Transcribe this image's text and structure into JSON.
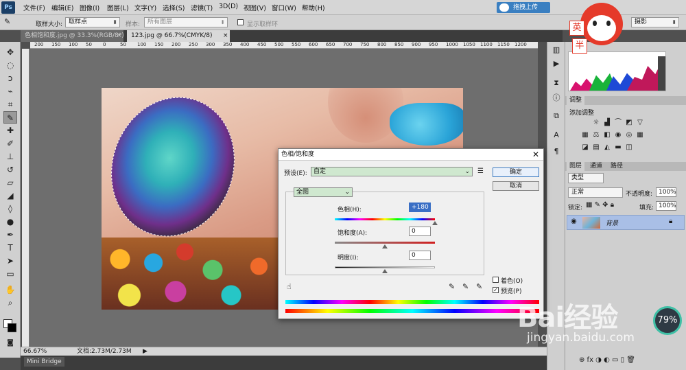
{
  "menubar": {
    "logo": "Ps",
    "items": [
      "文件(F)",
      "编辑(E)",
      "图像(I)",
      "图层(L)",
      "文字(Y)",
      "选择(S)",
      "滤镜(T)",
      "3D(D)",
      "视图(V)",
      "窗口(W)",
      "帮助(H)"
    ],
    "upload_label": "拖拽上传",
    "workspace": "摄影"
  },
  "options": {
    "sample_size_label": "取样大小:",
    "sample_size_value": "取样点",
    "sample_label": "样本:",
    "sample_value": "所有图层",
    "show_ring_label": "显示取样环"
  },
  "tabs": [
    {
      "label": "色相饱和度.jpg @ 33.3%(RGB/8*)",
      "close": "×"
    },
    {
      "label": "123.jpg @ 66.7%(CMYK/8)",
      "close": "×"
    }
  ],
  "ruler_h": [
    "200",
    "150",
    "100",
    "50",
    "0",
    "50",
    "100",
    "150",
    "200",
    "250",
    "300",
    "350",
    "400",
    "450",
    "500",
    "550",
    "600",
    "650",
    "700",
    "750",
    "800",
    "850",
    "900",
    "950",
    "1000",
    "1050",
    "1100",
    "1150",
    "1200"
  ],
  "status": {
    "zoom": "66.67%",
    "doc": "文档:2.73M/2.73M"
  },
  "minibridge": "Mini Bridge",
  "panels": {
    "adjust_tab": "调整",
    "adjust_add": "添加调整",
    "layer_tabs": [
      "图层",
      "通道",
      "路径"
    ],
    "kind": "类型",
    "blend": "正常",
    "opacity_label": "不透明度:",
    "opacity_value": "100%",
    "lock_label": "锁定:",
    "fill_label": "填充:",
    "fill_value": "100%",
    "layer_name": "背景"
  },
  "dialog": {
    "title": "色相/饱和度",
    "close": "✕",
    "preset_label": "预设(E):",
    "preset_value": "自定",
    "ok": "确定",
    "cancel": "取消",
    "channel": "全图",
    "hue_label": "色相(H):",
    "hue_value": "+180",
    "hue_level": 1.0,
    "sat_label": "饱和度(A):",
    "sat_value": "0",
    "sat_level": 0.5,
    "light_label": "明度(I):",
    "light_value": "0",
    "light_level": 0.5,
    "colorize_label": "着色(O)",
    "colorize_checked": false,
    "preview_label": "预览(P)",
    "preview_checked": true
  },
  "watermark": {
    "brand": "Bai经验",
    "url": "jingyan.baidu.com",
    "badge": "79%",
    "mascot_text_1": "英",
    "mascot_text_2": "半"
  },
  "colors": {
    "accent": "#3a7fc1",
    "layer_selected": "#a9bfe6",
    "badge_ring": "#3fc0a6"
  }
}
